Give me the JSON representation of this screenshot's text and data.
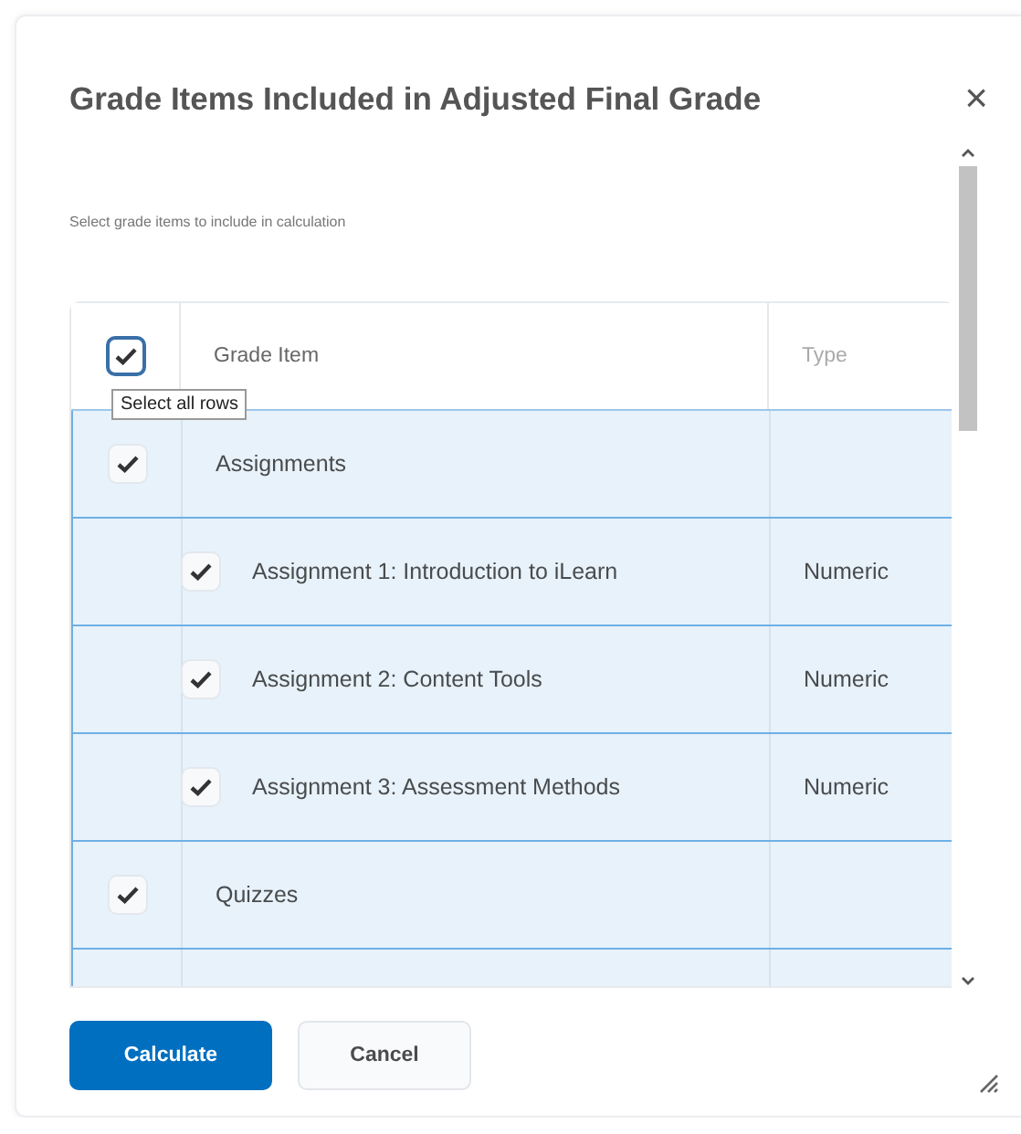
{
  "dialog": {
    "title": "Grade Items Included in Adjusted Final Grade",
    "close": "×"
  },
  "instructions": "Select grade items to include in calculation",
  "table": {
    "header": {
      "checked": true,
      "columns": [
        "Grade Item",
        "Type"
      ],
      "tooltip": "Select all rows"
    },
    "rows": [
      {
        "name": "Assignments",
        "type": "",
        "checked": true,
        "children": [
          {
            "name": "Assignment 1: Introduction to iLearn",
            "type": "Numeric",
            "checked": true
          },
          {
            "name": "Assignment 2: Content Tools",
            "type": "Numeric",
            "checked": true
          },
          {
            "name": "Assignment 3: Assessment Methods",
            "type": "Numeric",
            "checked": true
          }
        ]
      },
      {
        "name": "Quizzes",
        "type": "",
        "checked": true
      }
    ]
  },
  "buttons": [
    {
      "label": "Calculate",
      "kind": "primary"
    },
    {
      "label": "Cancel",
      "kind": "secondary"
    }
  ]
}
